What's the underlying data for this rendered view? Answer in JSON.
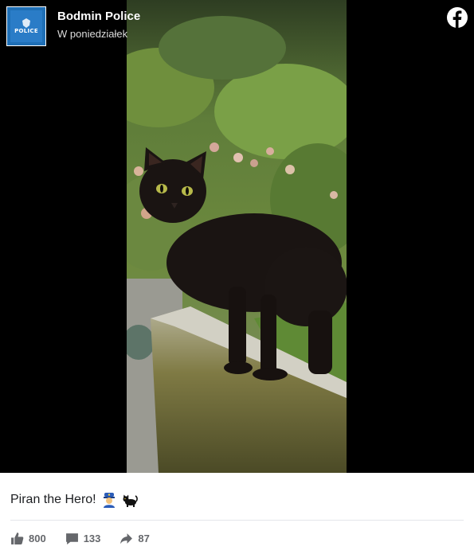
{
  "post": {
    "page_name": "Bodmin Police",
    "time": "W poniedziałek",
    "avatar_badge_text": "POLICE",
    "caption_text": "Piran the Hero!",
    "caption_emojis": [
      "police-officer-emoji",
      "black-cat-emoji"
    ],
    "photo_subject": "black-cat-on-mossy-wall"
  },
  "stats": {
    "likes": "800",
    "comments": "133",
    "shares": "87"
  },
  "colors": {
    "media_background": "#000000",
    "text_primary": "#1c1e21",
    "text_secondary": "#65676b",
    "avatar_blue": "#1f6fb6"
  }
}
